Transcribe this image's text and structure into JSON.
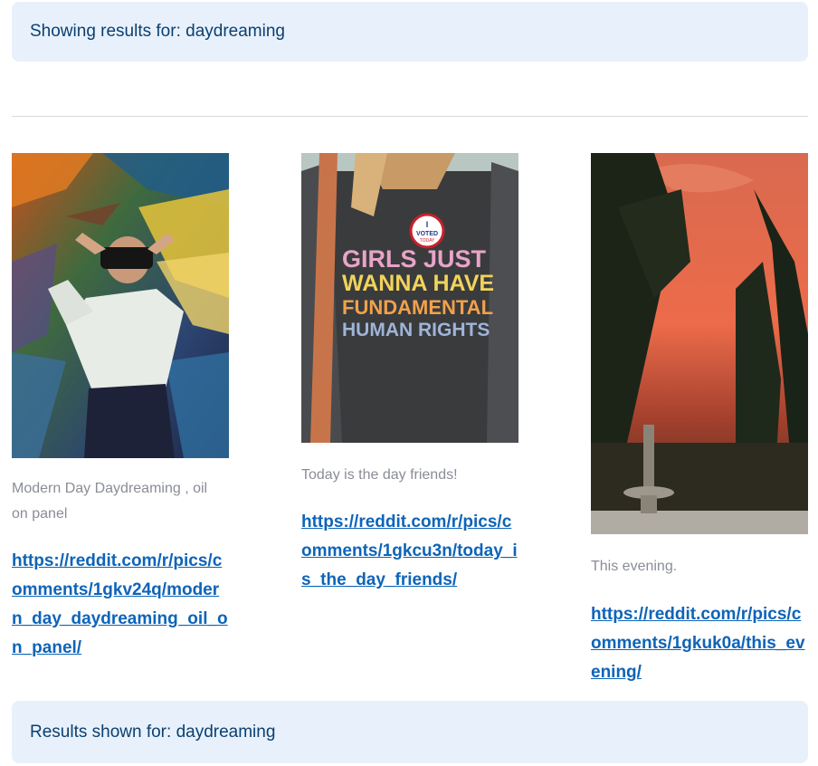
{
  "header": {
    "text": "Showing results for: daydreaming"
  },
  "results": [
    {
      "caption": "Modern Day Daydreaming , oil on panel",
      "url": "https://reddit.com/r/pics/comments/1gkv24q/modern_day_daydreaming_oil_on_panel/",
      "image_alt": "Oil painting of a woman wearing a VR headset"
    },
    {
      "caption": "Today is the day friends!",
      "url": "https://reddit.com/r/pics/comments/1gkcu3n/today_is_the_day_friends/",
      "image_alt": "Person wearing a t-shirt and an I Voted sticker",
      "shirt_lines": [
        "GIRLS JUST",
        "WANNA HAVE",
        "FUNDAMENTAL",
        "HUMAN RIGHTS"
      ],
      "sticker_lines": [
        "I",
        "VOTED",
        "TODAY"
      ]
    },
    {
      "caption": "This evening.",
      "url": "https://reddit.com/r/pics/comments/1gkuk0a/this_evening/",
      "image_alt": "Sunset sky over a garden with cypress trees and a fountain"
    }
  ],
  "footer": {
    "text": "Results shown for: daydreaming"
  }
}
